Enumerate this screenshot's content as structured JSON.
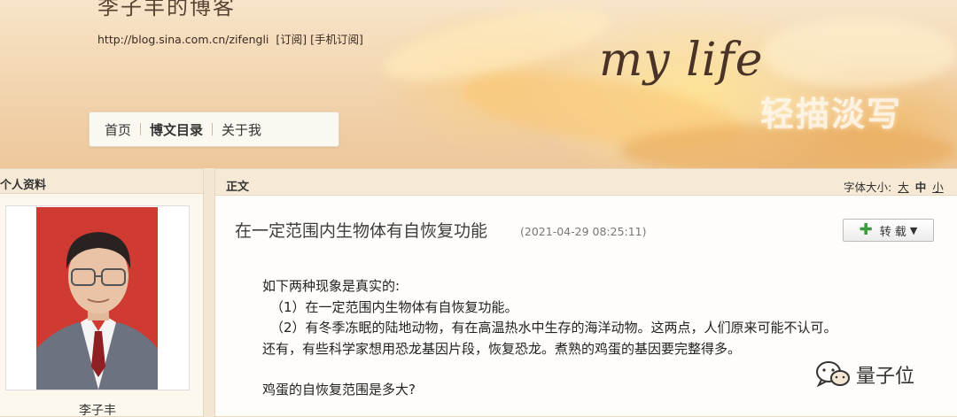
{
  "header": {
    "blog_title": "李子丰的博客",
    "blog_url": "http://blog.sina.com.cn/zifengli",
    "subscribe": "[订阅]",
    "mobile_subscribe": "[手机订阅]",
    "banner_script": "my life",
    "banner_tagline": "轻描淡写"
  },
  "nav": {
    "items": [
      {
        "label": "首页"
      },
      {
        "label": "博文目录"
      },
      {
        "label": "关于我"
      }
    ]
  },
  "sidebar": {
    "heading": "个人资料",
    "username": "李子丰"
  },
  "main": {
    "heading": "正文",
    "font_size_label": "字体大小:",
    "font_sizes": [
      "大",
      "中",
      "小"
    ],
    "article_title": "在一定范围内生物体有自恢复功能",
    "article_time": "(2021-04-29 08:25:11)",
    "repost_label": "转 载",
    "body": [
      "如下两种现象是真实的:",
      "（1）在一定范围内生物体有自恢复功能。",
      "（2）有冬季冻眠的陆地动物，有在高温热水中生存的海洋动物。这两点，人们原来可能不认可。",
      "还有，有些科学家想用恐龙基因片段，恢复恐龙。煮熟的鸡蛋的基因要完整得多。",
      "鸡蛋的自恢复范围是多大?"
    ]
  },
  "watermark": {
    "text": "量子位",
    "icon": "wechat-icon"
  }
}
